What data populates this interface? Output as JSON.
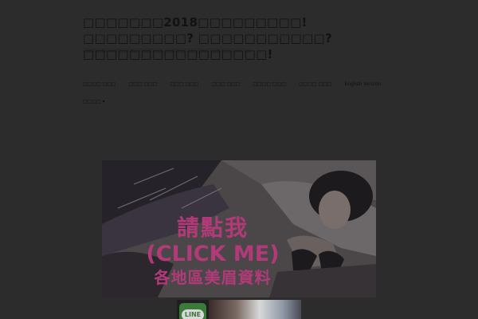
{
  "header": {
    "site_title": "□□□□□□□2018□□□□□□□□□! □□□□□□□□□? □□□□□□□□□□□? □□□□□□□□□□□□□□□□!",
    "tagline": "□□□□□□□□□□□□□□□□□□□□□□□□□□□□□□□□□□□□□□□□□□□□□□□□□□□□□□□□□□□□□~"
  },
  "nav": {
    "items": [
      "□□□□ □□□",
      "□□□ □□□",
      "□□□ □□□",
      "□□□ □□□",
      "□□□□ □□□",
      "□□□□ □□□",
      "English Version",
      "□□□□ ▾"
    ]
  },
  "banner": {
    "line1": "請點我",
    "line2": "(CLICK ME)",
    "line3": "各地區美眉資料",
    "accent_color": "#b23a78"
  },
  "line_banner": {
    "logo_text": "LINE",
    "logo_color": "#3b7b3a"
  }
}
